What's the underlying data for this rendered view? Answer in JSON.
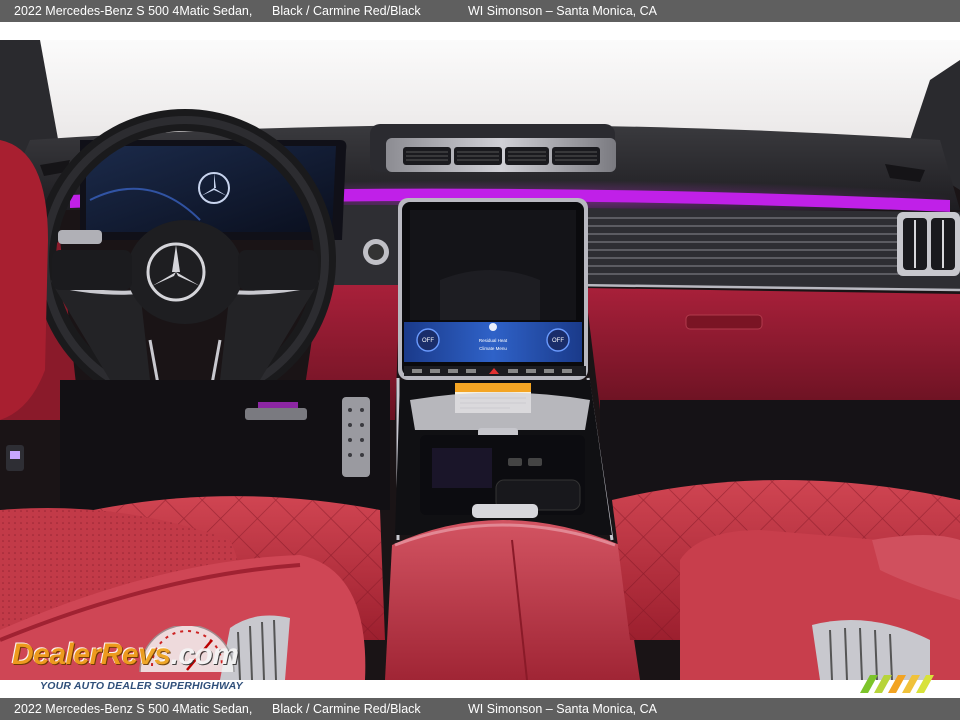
{
  "caption": {
    "vehicle": "2022 Mercedes-Benz S 500 4Matic Sedan,",
    "colors": "Black / Carmine Red/Black",
    "dealer": "WI Simonson – Santa Monica, CA"
  },
  "watermark": {
    "logo_text": "DealerRevs",
    "logo_suffix": ".com",
    "tagline": "YOUR AUTO DEALER SUPERHIGHWAY"
  },
  "screen": {
    "left_button": "OFF",
    "right_button": "OFF",
    "center_line1": "Residual Heat",
    "center_line2": "Climate Menu"
  },
  "colors": {
    "ambient_light": "#c020e8",
    "leather": "#b8283a",
    "caption_bar": "#5f5f5f",
    "logo": "#f0a21a"
  }
}
